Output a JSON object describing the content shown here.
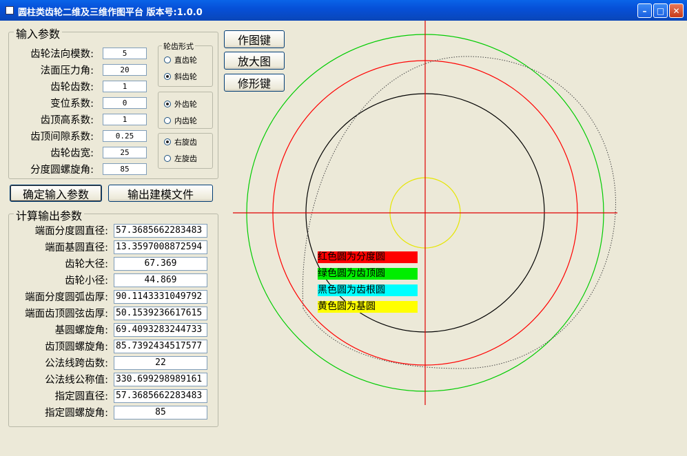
{
  "window": {
    "title": "圆柱类齿轮二维及三维作图平台 版本号:1.0.0"
  },
  "input_group": {
    "legend": "输入参数",
    "fields": [
      {
        "label": "齿轮法向模数:",
        "value": "5"
      },
      {
        "label": "法面压力角:",
        "value": "20"
      },
      {
        "label": "齿轮齿数:",
        "value": "1"
      },
      {
        "label": "变位系数:",
        "value": "0"
      },
      {
        "label": "齿顶高系数:",
        "value": "1"
      },
      {
        "label": "齿顶间隙系数:",
        "value": "0.25"
      },
      {
        "label": "齿轮齿宽:",
        "value": "25"
      },
      {
        "label": "分度圆螺旋角:",
        "value": "85"
      }
    ],
    "gear_form": {
      "legend": "轮齿形式",
      "options": [
        {
          "label": "直齿轮",
          "selected": false
        },
        {
          "label": "斜齿轮",
          "selected": true
        }
      ]
    },
    "gear_type": {
      "options": [
        {
          "label": "外齿轮",
          "selected": true
        },
        {
          "label": "内齿轮",
          "selected": false
        }
      ]
    },
    "helix_dir": {
      "options": [
        {
          "label": "右旋齿",
          "selected": true
        },
        {
          "label": "左旋齿",
          "selected": false
        }
      ]
    }
  },
  "buttons": {
    "confirm": "确定输入参数",
    "export": "输出建模文件",
    "draw": "作图键",
    "zoom": "放大图",
    "modify": "修形键"
  },
  "output_group": {
    "legend": "计算输出参数",
    "fields": [
      {
        "label": "端面分度圆直径:",
        "value": "57.3685662283483"
      },
      {
        "label": "端面基圆直径:",
        "value": "13.3597008872594"
      },
      {
        "label": "齿轮大径:",
        "value": "67.369"
      },
      {
        "label": "齿轮小径:",
        "value": "44.869"
      },
      {
        "label": "端面分度圆弧齿厚:",
        "value": "90.1143331049792"
      },
      {
        "label": "端面齿顶圆弦齿厚:",
        "value": "50.1539236617615"
      },
      {
        "label": "基圆螺旋角:",
        "value": "69.4093283244733"
      },
      {
        "label": "齿顶圆螺旋角:",
        "value": "85.7392434517577"
      },
      {
        "label": "公法线跨齿数:",
        "value": "22"
      },
      {
        "label": "公法线公称值:",
        "value": "330.699298989161"
      },
      {
        "label": "指定圆直径:",
        "value": "57.3685662283483"
      },
      {
        "label": "指定圆螺旋角:",
        "value": "85"
      }
    ]
  },
  "legend_labels": [
    {
      "text": "红色圆为分度圆",
      "color": "#ff0000"
    },
    {
      "text": "绿色圆为齿顶圆",
      "color": "#00ee00"
    },
    {
      "text": "黑色圆为齿根圆",
      "color": "#00ffff"
    },
    {
      "text": "黄色圆为基圆",
      "color": "#ffff00"
    }
  ],
  "colors": {
    "pitch_circle": "#ff0000",
    "tip_circle": "#00cc00",
    "root_circle": "#000000",
    "base_circle": "#e6e600",
    "crosshair": "#e00000"
  }
}
